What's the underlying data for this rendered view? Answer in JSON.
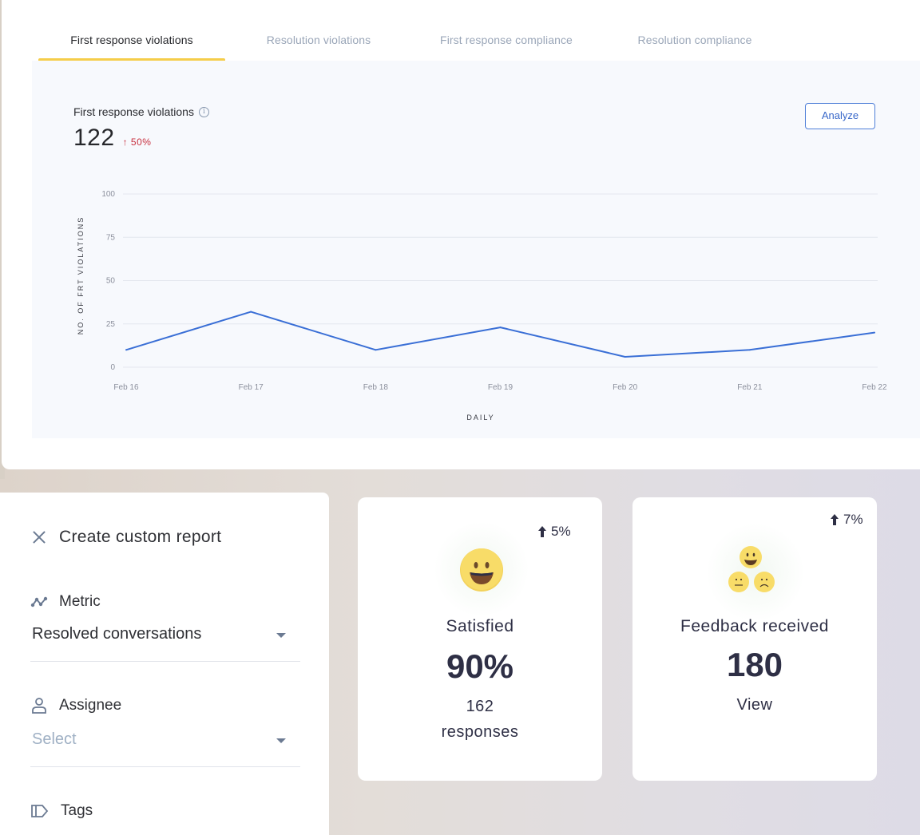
{
  "tabs": [
    {
      "label": "First response violations",
      "active": true
    },
    {
      "label": "Resolution violations",
      "active": false
    },
    {
      "label": "First response compliance",
      "active": false
    },
    {
      "label": "Resolution compliance",
      "active": false
    }
  ],
  "metric": {
    "title": "First response violations",
    "info_icon": "i",
    "value": "122",
    "change": "↑ 50%",
    "change_color": "#c8303f"
  },
  "analyze_button": "Analyze",
  "chart_data": {
    "type": "line",
    "title": "",
    "xlabel": "DAILY",
    "ylabel": "NO. OF FRT VIOLATIONS",
    "categories": [
      "Feb 16",
      "Feb 17",
      "Feb 18",
      "Feb 19",
      "Feb 20",
      "Feb 21",
      "Feb 22"
    ],
    "series": [
      {
        "name": "First response violations",
        "values": [
          10,
          32,
          10,
          23,
          6,
          10,
          20
        ],
        "color": "#3a6fd6"
      }
    ],
    "ylim": [
      0,
      100
    ],
    "yticks": [
      0,
      25,
      50,
      75,
      100
    ],
    "grid": true,
    "legend": "none"
  },
  "report": {
    "title": "Create custom report",
    "fields": [
      {
        "label": "Metric",
        "icon": "metric-icon",
        "value": "Resolved conversations",
        "placeholder": false
      },
      {
        "label": "Assignee",
        "icon": "user-icon",
        "value": "Select",
        "placeholder": true
      },
      {
        "label": "Tags",
        "icon": "tag-icon"
      }
    ]
  },
  "cards": [
    {
      "change": "5%",
      "label": "Satisfied",
      "value": "90%",
      "sub_line1": "162",
      "sub_line2": "responses",
      "icon": "happy-face-icon"
    },
    {
      "change": "7%",
      "label": "Feedback received",
      "value": "180",
      "sub_line1": "View",
      "icon": "feedback-faces-icon"
    }
  ]
}
